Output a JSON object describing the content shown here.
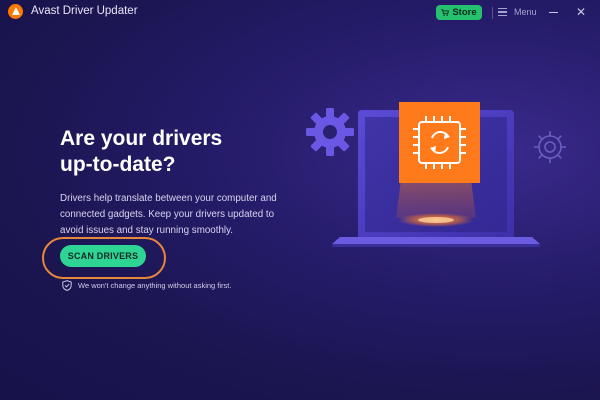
{
  "window": {
    "title": "Avast Driver Updater",
    "store_label": "Store",
    "menu_label": "Menu",
    "minimize_icon": "minimize-icon",
    "close_icon": "close-icon"
  },
  "main": {
    "headline_line1": "Are your drivers",
    "headline_line2": "up-to-date?",
    "description_lines": [
      "Drivers help translate between your computer and",
      "connected gadgets. Keep your drivers updated to",
      "avoid issues and stay running smoothly."
    ],
    "scan_button_label": "SCAN DRIVERS",
    "assurance_text": "We won't change anything without asking first."
  },
  "colors": {
    "background": "#1e1858",
    "accent_orange": "#ff7800",
    "scan_green": "#2fd494",
    "store_green": "#25c16f",
    "illustration_purple": "#5b4bd6"
  },
  "icons": {
    "logo": "avast-logo-icon",
    "store": "cart-icon",
    "menu": "hamburger-icon",
    "assurance": "shield-check-icon",
    "illustration": [
      "gear-icon",
      "laptop-icon",
      "chip-refresh-icon"
    ]
  }
}
